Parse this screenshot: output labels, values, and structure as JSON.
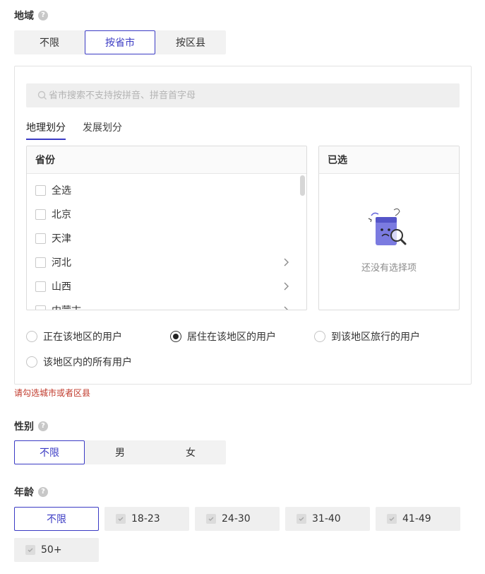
{
  "region": {
    "label": "地域",
    "options": [
      "不限",
      "按省市",
      "按区县"
    ],
    "selected_index": 1,
    "search_placeholder": "省市搜索不支持按拼音、拼音首字母",
    "tabs": [
      "地理划分",
      "发展划分"
    ],
    "provinces_header": "省份",
    "provinces": [
      {
        "name": "全选",
        "has_children": false
      },
      {
        "name": "北京",
        "has_children": false
      },
      {
        "name": "天津",
        "has_children": false
      },
      {
        "name": "河北",
        "has_children": true
      },
      {
        "name": "山西",
        "has_children": true
      },
      {
        "name": "内蒙古",
        "has_children": true
      }
    ],
    "selected_header": "已选",
    "empty_text": "还没有选择项",
    "user_types": [
      "正在该地区的用户",
      "居住在该地区的用户",
      "到该地区旅行的用户",
      "该地区内的所有用户"
    ],
    "user_type_selected": 1,
    "error": "请勾选城市或者区县"
  },
  "gender": {
    "label": "性别",
    "options": [
      "不限",
      "男",
      "女"
    ],
    "selected_index": 0
  },
  "age": {
    "label": "年龄",
    "options": [
      "不限",
      "18-23",
      "24-30",
      "31-40",
      "41-49",
      "50+"
    ],
    "selected_index": 0
  },
  "colors": {
    "accent": "#3b3bc4",
    "error": "#c0392b",
    "illustration": "#6b6bdc"
  }
}
